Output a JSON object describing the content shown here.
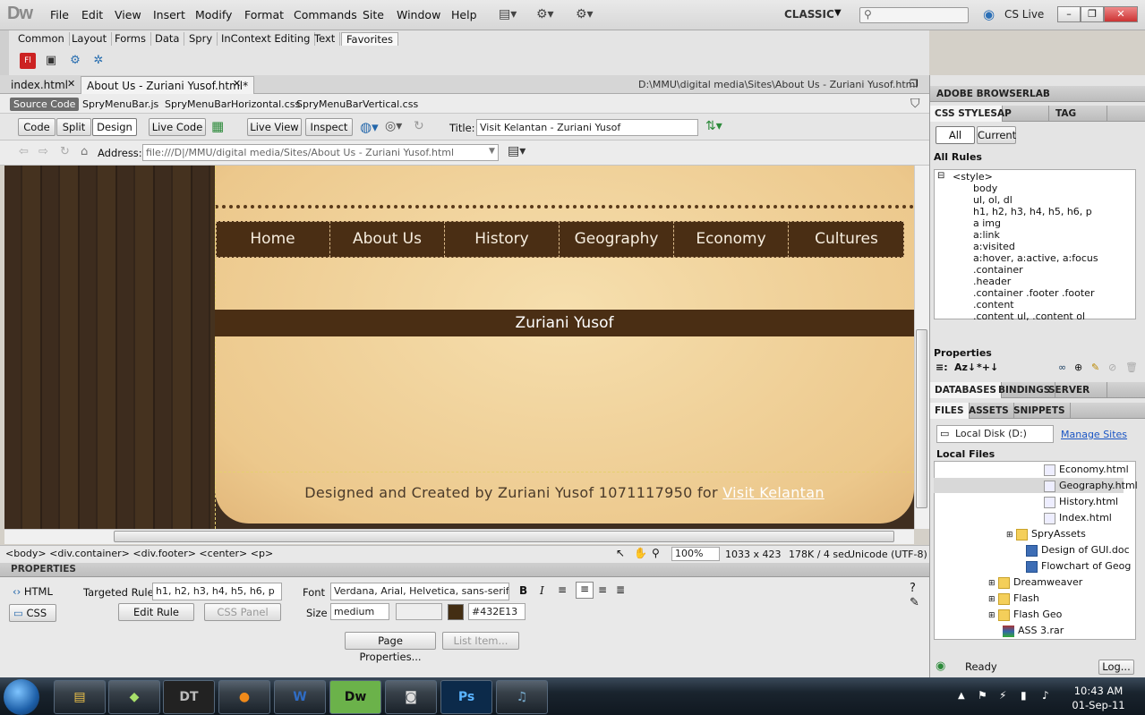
{
  "app": {
    "logo": "Dw",
    "workspace": "CLASSIC",
    "cslive": "CS Live"
  },
  "menu": [
    "File",
    "Edit",
    "View",
    "Insert",
    "Modify",
    "Format",
    "Commands",
    "Site",
    "Window",
    "Help"
  ],
  "insert_tabs": [
    "Common",
    "Layout",
    "Forms",
    "Data",
    "Spry",
    "InContext Editing",
    "Text",
    "Favorites"
  ],
  "doc_tabs": {
    "tab1": "index.html",
    "tab2": "About Us - Zuriani Yusof.html*",
    "path": "D:\\MMU\\digital media\\Sites\\About Us - Zuriani Yusof.html"
  },
  "related_files": [
    "Source Code",
    "SpryMenuBar.js",
    "SpryMenuBarHorizontal.css",
    "SpryMenuBarVertical.css"
  ],
  "doc_toolbar": {
    "code": "Code",
    "split": "Split",
    "design": "Design",
    "live_code": "Live Code",
    "live_view": "Live View",
    "inspect": "Inspect",
    "title_label": "Title:",
    "title_value": "Visit Kelantan - Zuriani Yusof"
  },
  "address": {
    "label": "Address:",
    "value": "file:///D|/MMU/digital media/Sites/About Us - Zuriani Yusof.html"
  },
  "page": {
    "nav": [
      "Home",
      "About Us",
      "History",
      "Geography",
      "Economy",
      "Cultures"
    ],
    "title_band": "Zuriani Yusof",
    "footer_prefix": "Designed and Created by Zuriani Yusof 1071117950 for ",
    "footer_link": "Visit Kelantan"
  },
  "status": {
    "tags": "<body> <div.container> <div.footer> <center> <p>",
    "zoom": "100%",
    "dims": "1033 x 423",
    "size": "178K / 4 sec",
    "encoding": "Unicode (UTF-8)"
  },
  "properties": {
    "header": "PROPERTIES",
    "html": "HTML",
    "css": "CSS",
    "targeted_label": "Targeted Rule",
    "targeted_value": "h1, h2, h3, h4, h5, h6, p",
    "edit_rule": "Edit Rule",
    "css_panel": "CSS Panel",
    "font_label": "Font",
    "font_value": "Verdana, Arial, Helvetica, sans-serif",
    "size_label": "Size",
    "size_value": "medium",
    "color_value": "#432E13",
    "page_props": "Page Properties...",
    "list_item": "List Item..."
  },
  "right": {
    "browserlab": "ADOBE BROWSERLAB",
    "css_tabs": [
      "CSS STYLES",
      "AP ELEMENTS",
      "TAG INSPECTOR"
    ],
    "all": "All",
    "current": "Current",
    "all_rules": "All Rules",
    "style_root": "<style>",
    "rules": [
      "body",
      "ul, ol, dl",
      "h1, h2, h3, h4, h5, h6, p",
      "a img",
      "a:link",
      "a:visited",
      "a:hover, a:active, a:focus",
      ".container",
      ".header",
      ".container .footer .footer",
      ".content",
      ".content ul, .content ol"
    ],
    "properties": "Properties",
    "db_tabs": [
      "DATABASES",
      "BINDINGS",
      "SERVER BEHAVIORS"
    ],
    "file_tabs": [
      "FILES",
      "ASSETS",
      "SNIPPETS"
    ],
    "disk": "Local Disk (D:)",
    "manage": "Manage Sites",
    "local_files": "Local Files",
    "files": [
      "Economy.html",
      "Geography.html",
      "History.html",
      "Index.html",
      "SpryAssets",
      "Design of GUI.doc",
      "Flowchart of Geog",
      "Dreamweaver",
      "Flash",
      "Flash Geo",
      "ASS 3.rar"
    ],
    "ready": "Ready",
    "log": "Log..."
  },
  "taskbar": {
    "dt": "DT",
    "dw": "Dw",
    "ps": "Ps",
    "time": "10:43 AM",
    "date": "01-Sep-11"
  },
  "colors": {
    "nav_bg": "#4a2e14",
    "parchment": "#f1d39c",
    "dw_green": "#35a03a"
  }
}
